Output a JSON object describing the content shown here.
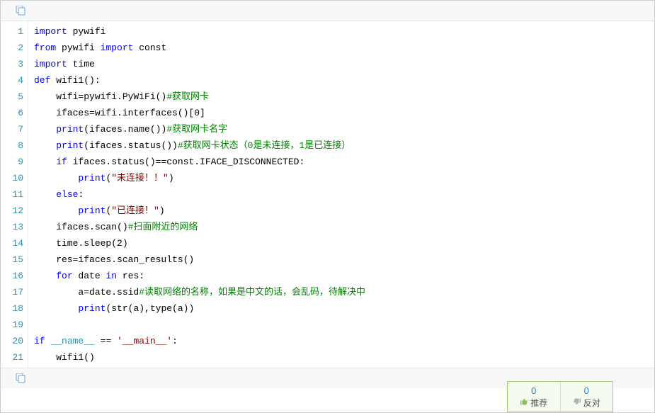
{
  "icons": {
    "copy": "copy-icon",
    "thumb_up": "thumb-up-icon",
    "thumb_down": "thumb-down-icon"
  },
  "code": {
    "lines": [
      {
        "n": 1,
        "tokens": [
          {
            "t": "import",
            "c": "kw"
          },
          {
            "t": " pywifi"
          }
        ]
      },
      {
        "n": 2,
        "tokens": [
          {
            "t": "from",
            "c": "kw"
          },
          {
            "t": " pywifi "
          },
          {
            "t": "import",
            "c": "kw"
          },
          {
            "t": " const"
          }
        ]
      },
      {
        "n": 3,
        "tokens": [
          {
            "t": "import",
            "c": "kw"
          },
          {
            "t": " time"
          }
        ]
      },
      {
        "n": 4,
        "tokens": [
          {
            "t": "def",
            "c": "kw"
          },
          {
            "t": " wifi1():"
          }
        ]
      },
      {
        "n": 5,
        "tokens": [
          {
            "t": "    wifi=pywifi.PyWiFi()"
          },
          {
            "t": "#获取网卡",
            "c": "cm"
          }
        ]
      },
      {
        "n": 6,
        "tokens": [
          {
            "t": "    ifaces=wifi.interfaces()[0]"
          }
        ]
      },
      {
        "n": 7,
        "tokens": [
          {
            "t": "    "
          },
          {
            "t": "print",
            "c": "kw"
          },
          {
            "t": "(ifaces.name())"
          },
          {
            "t": "#获取网卡名字",
            "c": "cm"
          }
        ]
      },
      {
        "n": 8,
        "tokens": [
          {
            "t": "    "
          },
          {
            "t": "print",
            "c": "kw"
          },
          {
            "t": "(ifaces.status())"
          },
          {
            "t": "#获取网卡状态（0是未连接，1是已连接）",
            "c": "cm"
          }
        ]
      },
      {
        "n": 9,
        "tokens": [
          {
            "t": "    "
          },
          {
            "t": "if",
            "c": "kw"
          },
          {
            "t": " ifaces.status()==const.IFACE_DISCONNECTED:"
          }
        ]
      },
      {
        "n": 10,
        "tokens": [
          {
            "t": "        "
          },
          {
            "t": "print",
            "c": "kw"
          },
          {
            "t": "("
          },
          {
            "t": "\"未连接！！\"",
            "c": "str"
          },
          {
            "t": ")"
          }
        ]
      },
      {
        "n": 11,
        "tokens": [
          {
            "t": "    "
          },
          {
            "t": "else",
            "c": "kw"
          },
          {
            "t": ":"
          }
        ]
      },
      {
        "n": 12,
        "tokens": [
          {
            "t": "        "
          },
          {
            "t": "print",
            "c": "kw"
          },
          {
            "t": "("
          },
          {
            "t": "\"已连接！\"",
            "c": "str"
          },
          {
            "t": ")"
          }
        ]
      },
      {
        "n": 13,
        "tokens": [
          {
            "t": "    ifaces.scan()"
          },
          {
            "t": "#扫面附近的网络",
            "c": "cm"
          }
        ]
      },
      {
        "n": 14,
        "tokens": [
          {
            "t": "    time.sleep(2)"
          }
        ]
      },
      {
        "n": 15,
        "tokens": [
          {
            "t": "    res=ifaces.scan_results()"
          }
        ]
      },
      {
        "n": 16,
        "tokens": [
          {
            "t": "    "
          },
          {
            "t": "for",
            "c": "kw"
          },
          {
            "t": " date "
          },
          {
            "t": "in",
            "c": "kw"
          },
          {
            "t": " res:"
          }
        ]
      },
      {
        "n": 17,
        "tokens": [
          {
            "t": "        a=date.ssid"
          },
          {
            "t": "#读取网络的名称，如果是中文的话，会乱码，待解决中",
            "c": "cm"
          }
        ]
      },
      {
        "n": 18,
        "tokens": [
          {
            "t": "        "
          },
          {
            "t": "print",
            "c": "kw"
          },
          {
            "t": "(str(a),type(a))"
          }
        ]
      },
      {
        "n": 19,
        "tokens": []
      },
      {
        "n": 20,
        "tokens": [
          {
            "t": "if",
            "c": "kw"
          },
          {
            "t": " "
          },
          {
            "t": "__name__",
            "c": "cname"
          },
          {
            "t": " == "
          },
          {
            "t": "'__main__'",
            "c": "str"
          },
          {
            "t": ":"
          }
        ]
      },
      {
        "n": 21,
        "tokens": [
          {
            "t": "    wifi1()"
          }
        ]
      }
    ]
  },
  "votes": {
    "up_count": "0",
    "up_label": "推荐",
    "down_count": "0",
    "down_label": "反对"
  }
}
